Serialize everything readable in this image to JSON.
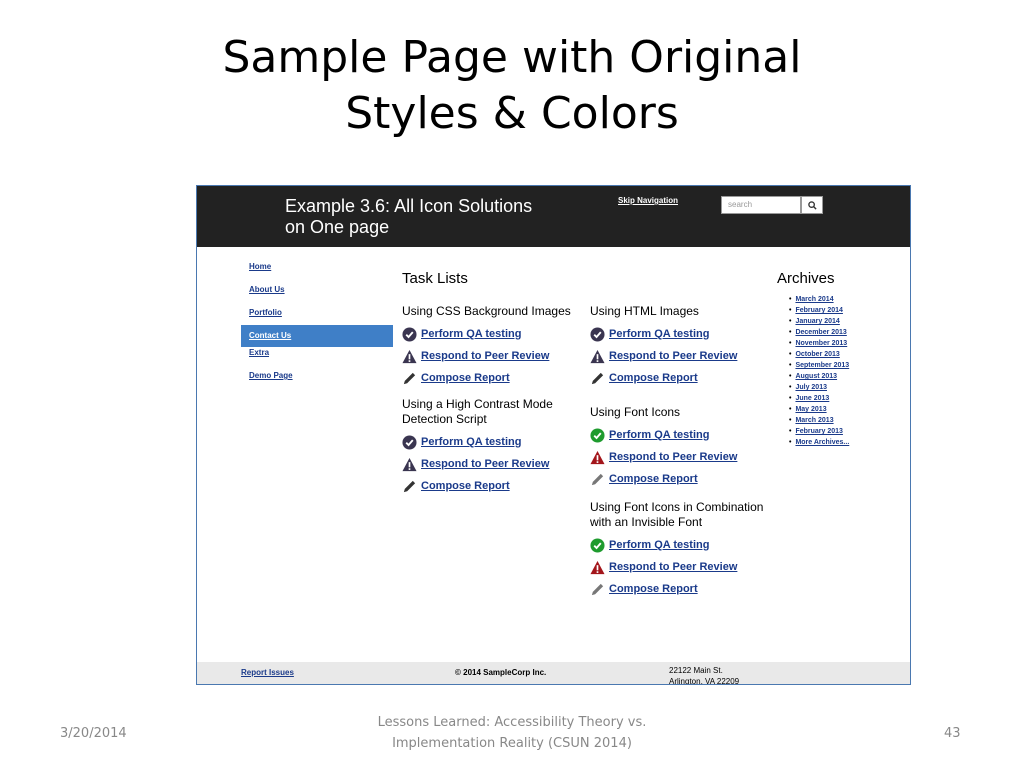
{
  "slide": {
    "title_line1": "Sample Page with Original",
    "title_line2": "Styles &  Colors",
    "footer_date": "3/20/2014",
    "footer_center_line1": "Lessons Learned: Accessibility Theory vs.",
    "footer_center_line2": "Implementation Reality (CSUN 2014)",
    "page_number": "43"
  },
  "header": {
    "title_line1": "Example 3.6: All Icon Solutions",
    "title_line2": "on One page",
    "skip_link": "Skip Navigation",
    "search_placeholder": "search"
  },
  "nav": {
    "items": [
      {
        "label": "Home"
      },
      {
        "label": "About Us"
      },
      {
        "label": "Portfolio"
      },
      {
        "label": "Contact Us",
        "active": true
      },
      {
        "label": "Extra"
      },
      {
        "label": "Demo Page"
      }
    ]
  },
  "main": {
    "heading": "Task Lists",
    "sections": [
      {
        "title": "Using CSS Background Images",
        "style": "dark",
        "tasks": [
          "Perform QA testing",
          "Respond to Peer Review",
          "Compose Report"
        ]
      },
      {
        "title": "Using a High Contrast Mode Detection Script",
        "style": "dark",
        "tasks": [
          "Perform QA testing",
          "Respond to Peer Review",
          "Compose Report"
        ]
      },
      {
        "title": "Using HTML Images",
        "style": "dark",
        "tasks": [
          "Perform QA testing",
          "Respond to Peer Review",
          "Compose Report"
        ]
      },
      {
        "title": "Using Font Icons",
        "style": "color",
        "tasks": [
          "Perform QA testing",
          "Respond to Peer Review",
          "Compose Report"
        ]
      },
      {
        "title": "Using Font Icons in Combination with an Invisible Font",
        "style": "color",
        "tasks": [
          "Perform QA testing",
          "Respond to Peer Review",
          "Compose Report"
        ]
      }
    ]
  },
  "archives": {
    "heading": "Archives",
    "items": [
      "March 2014",
      "February 2014",
      "January 2014",
      "December 2013",
      "November 2013",
      "October 2013",
      "September 2013",
      "August 2013",
      "July 2013",
      "June 2013",
      "May 2013",
      "March 2013",
      "February 2013",
      "More Archives..."
    ]
  },
  "footer": {
    "report_link": "Report Issues",
    "copyright": "© 2014 SampleCorp Inc.",
    "address_line1": "22122 Main St.",
    "address_line2": "Arlington, VA 22209"
  },
  "colors": {
    "header_bg": "#222222",
    "active_nav": "#3f7fc7",
    "link": "#1a3a8a",
    "check_dark": "#3a3550",
    "check_green": "#1e9b2e",
    "warn_red": "#a3151b"
  },
  "icons": [
    "check-circle-icon",
    "warning-triangle-icon",
    "pencil-icon",
    "search-icon"
  ]
}
